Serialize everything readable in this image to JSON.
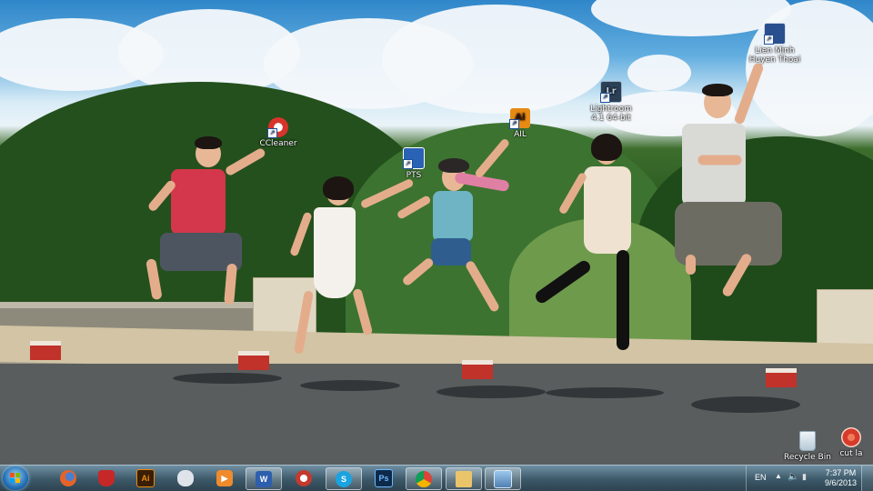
{
  "desktop": {
    "icons": [
      {
        "id": "ccleaner",
        "label": "CCleaner",
        "icon": "ccleaner-icon",
        "color": "#d8342c"
      },
      {
        "id": "pts",
        "label": "PTS",
        "icon": "photoshop-shortcut-icon",
        "color": "#2a62b6"
      },
      {
        "id": "ail",
        "label": "AIL",
        "icon": "illustrator-shortcut-icon",
        "color": "#e68a14"
      },
      {
        "id": "lightroom",
        "label_line1": "Lightroom",
        "label_line2": "4.1 64-bit",
        "icon": "lightroom-icon",
        "color": "#2b3f55"
      },
      {
        "id": "lienminh",
        "label_line1": "Lien Minh",
        "label_line2": "Huyen Thoai",
        "icon": "game-icon",
        "color": "#2a4f8e"
      },
      {
        "id": "recycle",
        "label": "Recycle Bin",
        "icon": "recycle-bin-icon"
      },
      {
        "id": "cutla",
        "label": "cut la",
        "icon": "red-circle-icon",
        "color": "#d63a2a"
      }
    ]
  },
  "taskbar": {
    "apps": [
      {
        "id": "firefox",
        "icon": "firefox-icon",
        "color": "#e6632a",
        "glyph": ""
      },
      {
        "id": "bag",
        "icon": "red-bag-icon",
        "color": "#c62828",
        "glyph": ""
      },
      {
        "id": "illustrator",
        "icon": "illustrator-icon",
        "color": "#e68a14",
        "glyph": "Ai"
      },
      {
        "id": "gamepad",
        "icon": "gamepad-icon",
        "color": "#dfe4ea",
        "glyph": ""
      },
      {
        "id": "media",
        "icon": "media-player-icon",
        "color": "#ef8b2c",
        "glyph": ""
      },
      {
        "id": "word",
        "icon": "word-icon",
        "color": "#2e5fae",
        "glyph": "W"
      },
      {
        "id": "pdf",
        "icon": "foxit-icon",
        "color": "#c43a2e",
        "glyph": ""
      },
      {
        "id": "skype",
        "icon": "skype-icon",
        "color": "#1aa3e0",
        "glyph": ""
      },
      {
        "id": "photoshop",
        "icon": "photoshop-icon",
        "color": "#1f4a7e",
        "glyph": "Ps"
      },
      {
        "id": "chrome",
        "icon": "chrome-icon",
        "color": "#3a8a3c",
        "glyph": ""
      },
      {
        "id": "explorer",
        "icon": "folder-icon",
        "color": "#e9c46a",
        "glyph": ""
      },
      {
        "id": "photoviewer",
        "icon": "photo-viewer-icon",
        "color": "#6ea8d8",
        "glyph": ""
      }
    ],
    "tray": {
      "language": "EN",
      "time": "7:37 PM",
      "date": "9/6/2013"
    }
  }
}
